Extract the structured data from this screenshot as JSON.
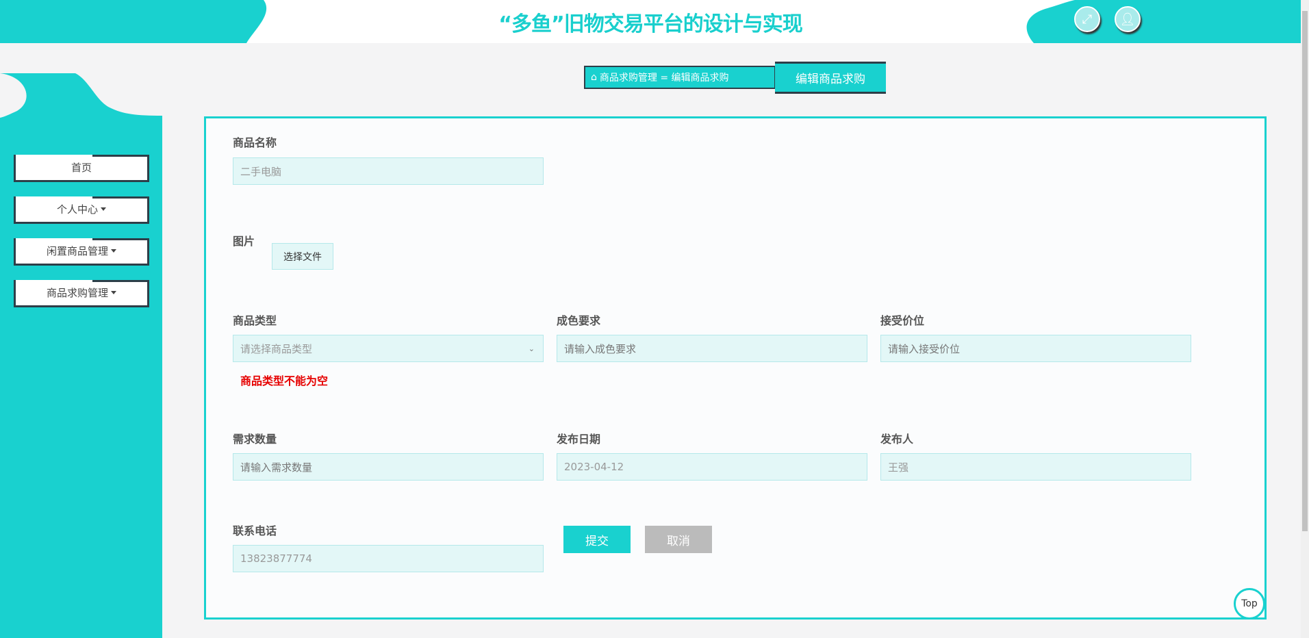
{
  "header": {
    "title": "“多鱼”旧物交易平台的设计与实现",
    "fullscreen_icon": "expand-icon",
    "user_icon": "user-icon"
  },
  "sidebar": {
    "items": [
      {
        "label": "首页"
      },
      {
        "label": "个人中心"
      },
      {
        "label": "闲置商品管理"
      },
      {
        "label": "商品求购管理"
      }
    ]
  },
  "breadcrumb": {
    "path": "商品求购管理 = 编辑商品求购",
    "current": "编辑商品求购"
  },
  "form": {
    "name": {
      "label": "商品名称",
      "value": "二手电脑"
    },
    "image": {
      "label": "图片",
      "button": "选择文件"
    },
    "type": {
      "label": "商品类型",
      "placeholder": "请选择商品类型",
      "error": "商品类型不能为空"
    },
    "condition": {
      "label": "成色要求",
      "placeholder": "请输入成色要求"
    },
    "price": {
      "label": "接受价位",
      "placeholder": "请输入接受价位"
    },
    "quantity": {
      "label": "需求数量",
      "placeholder": "请输入需求数量"
    },
    "date": {
      "label": "发布日期",
      "value": "2023-04-12"
    },
    "publisher": {
      "label": "发布人",
      "value": "王强"
    },
    "phone": {
      "label": "联系电话",
      "value": "13823877774"
    },
    "submit": "提交",
    "cancel": "取消"
  },
  "top_label": "Top",
  "colors": {
    "accent": "#19d1cf",
    "dark": "#2d3e48",
    "error": "#e60000"
  }
}
